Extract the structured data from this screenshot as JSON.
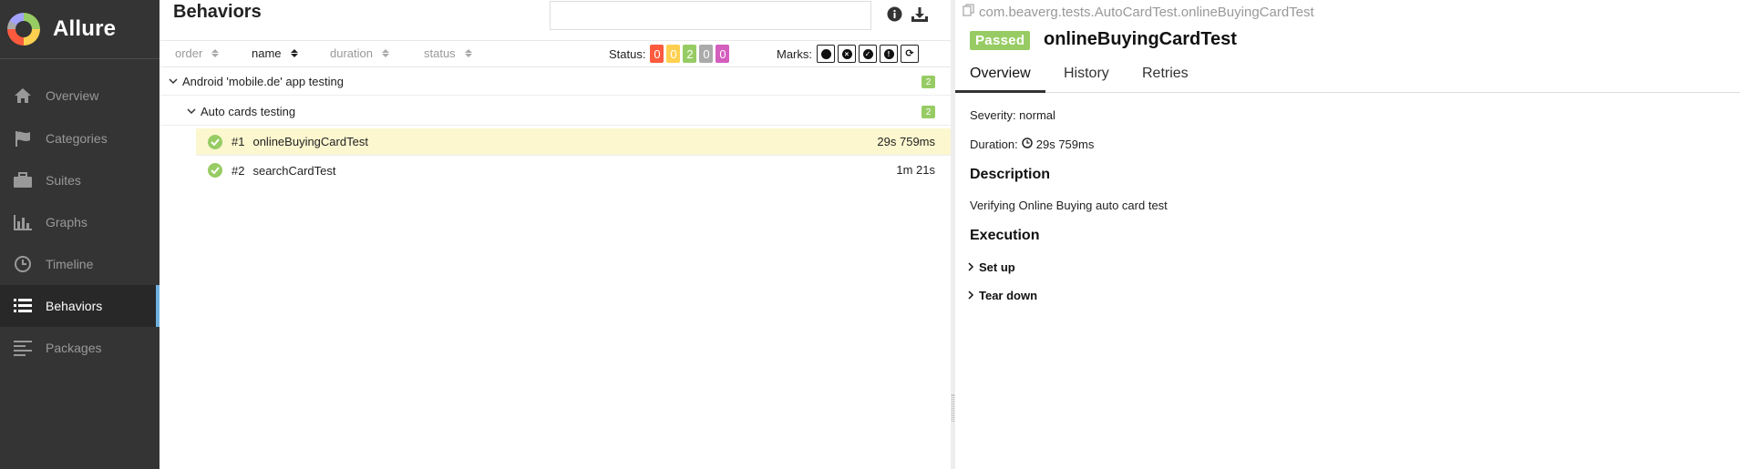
{
  "brand": {
    "name": "Allure"
  },
  "sidebar": {
    "items": [
      {
        "label": "Overview",
        "icon": "home-icon",
        "active": false
      },
      {
        "label": "Categories",
        "icon": "flag-icon",
        "active": false
      },
      {
        "label": "Suites",
        "icon": "briefcase-icon",
        "active": false
      },
      {
        "label": "Graphs",
        "icon": "bar-chart-icon",
        "active": false
      },
      {
        "label": "Timeline",
        "icon": "clock-icon",
        "active": false
      },
      {
        "label": "Behaviors",
        "icon": "list-icon",
        "active": true
      },
      {
        "label": "Packages",
        "icon": "align-left-icon",
        "active": false
      }
    ]
  },
  "left": {
    "title": "Behaviors",
    "search": {
      "value": "",
      "placeholder": ""
    },
    "sort": {
      "columns": [
        {
          "label": "order",
          "active": false
        },
        {
          "label": "name",
          "active": true
        },
        {
          "label": "duration",
          "active": false
        },
        {
          "label": "status",
          "active": false
        }
      ]
    },
    "status_filter": {
      "label": "Status:",
      "counts": [
        {
          "value": "0",
          "status": "failed",
          "color": "#fd5a3e"
        },
        {
          "value": "0",
          "status": "broken",
          "color": "#ffd050"
        },
        {
          "value": "2",
          "status": "passed",
          "color": "#97cc64"
        },
        {
          "value": "0",
          "status": "skipped",
          "color": "#aaaaaa"
        },
        {
          "value": "0",
          "status": "unknown",
          "color": "#d35ebe"
        }
      ]
    },
    "marks_filter": {
      "label": "Marks:",
      "marks": [
        "bomb-icon",
        "times-circle-icon",
        "check-circle-icon",
        "info-circle-icon",
        "refresh-icon"
      ]
    },
    "tree": {
      "epic": {
        "label": "Android 'mobile.de' app testing",
        "count": "2"
      },
      "feature": {
        "label": "Auto cards testing",
        "count": "2"
      },
      "tests": [
        {
          "num": "#1",
          "name": "onlineBuyingCardTest",
          "duration": "29s 759ms",
          "selected": true
        },
        {
          "num": "#2",
          "name": "searchCardTest",
          "duration": "1m 21s",
          "selected": false
        }
      ]
    }
  },
  "right": {
    "full_name": "com.beaverg.tests.AutoCardTest.onlineBuyingCardTest",
    "status": "Passed",
    "title": "onlineBuyingCardTest",
    "tabs": [
      "Overview",
      "History",
      "Retries"
    ],
    "active_tab": "Overview",
    "severity": "Severity: normal",
    "duration_label": "Duration:",
    "duration_value": "29s 759ms",
    "description_title": "Description",
    "description": "Verifying Online Buying auto card test",
    "execution_title": "Execution",
    "steps": [
      "Set up",
      "Tear down"
    ]
  },
  "colors": {
    "sidebar_bg": "#343434",
    "passed": "#97cc64",
    "selected_row": "#fcf7cf",
    "active_accent": "#6eb0e0"
  }
}
